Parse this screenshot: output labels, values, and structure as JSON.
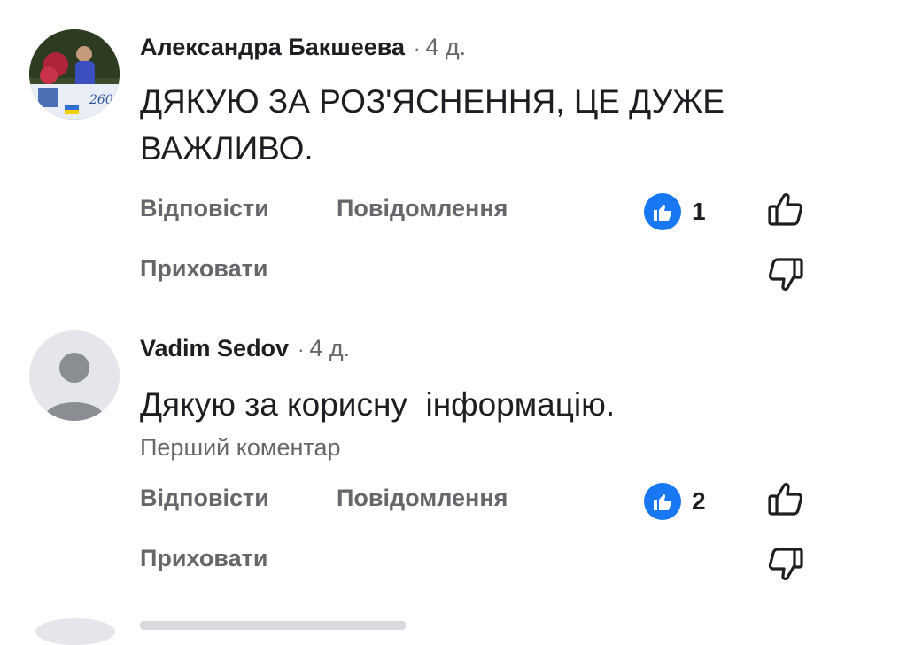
{
  "comments": [
    {
      "author": "Александра Бакшеева",
      "time": "4 д.",
      "text": "ДЯКУЮ ЗА РОЗ'ЯСНЕННЯ, ЦЕ ДУЖЕ ВАЖЛИВО.",
      "note": "",
      "actions": {
        "reply": "Відповісти",
        "message": "Повідомлення",
        "hide": "Приховати"
      },
      "reaction_count": "1",
      "avatar_badge": "260°",
      "avatar_icon": "profile-photo"
    },
    {
      "author": "Vadim Sedov",
      "time": "4 д.",
      "text": "Дякую за корисну  інформацію.",
      "note": "Перший коментар",
      "actions": {
        "reply": "Відповісти",
        "message": "Повідомлення",
        "hide": "Приховати"
      },
      "reaction_count": "2",
      "avatar_icon": "default-avatar-icon"
    }
  ],
  "colors": {
    "like_blue": "#1877f2",
    "secondary_text": "#65676b",
    "primary_text": "#1c1e21"
  }
}
